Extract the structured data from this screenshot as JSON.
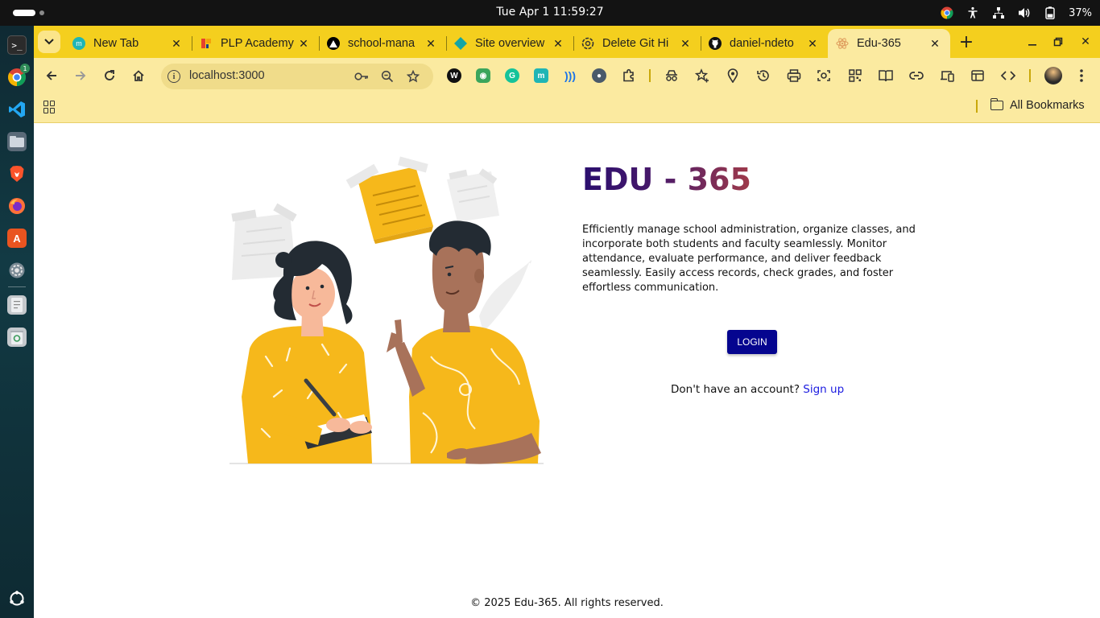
{
  "system": {
    "clock": "Tue Apr 1  11:59:27",
    "battery": "37%",
    "dock_badge": "1"
  },
  "tabs": [
    {
      "title": "New Tab",
      "favicon": "meta-m-icon",
      "color": "#1fb5b5"
    },
    {
      "title": "PLP Academy",
      "favicon": "plp-icon",
      "color": "#e8412c"
    },
    {
      "title": "school-mana",
      "favicon": "vercel-icon",
      "color": "#000000"
    },
    {
      "title": "Site overview",
      "favicon": "netlify-icon",
      "color": "#14a5a5"
    },
    {
      "title": "Delete Git Hi",
      "favicon": "openai-icon",
      "color": "#444444"
    },
    {
      "title": "daniel-ndeto",
      "favicon": "github-icon",
      "color": "#111111"
    },
    {
      "title": "Edu-365",
      "favicon": "react-icon",
      "color": "#e0a060",
      "active": true
    }
  ],
  "toolbar": {
    "url": "localhost:3000"
  },
  "bookmarks": {
    "all_label": "All Bookmarks"
  },
  "hero": {
    "title": "EDU - 365",
    "description": "Efficiently manage school administration, organize classes, and incorporate both students and faculty seamlessly. Monitor attendance, evaluate performance, and deliver feedback seamlessly. Easily access records, check grades, and foster effortless communication.",
    "login_label": "LOGIN",
    "signup_prompt": "Don't have an account?",
    "signup_link": "Sign up"
  },
  "footer": {
    "text": "© 2025 Edu-365. All rights reserved."
  },
  "colors": {
    "chrome_theme": "#f4cf1e",
    "toolbar": "#fbeaa0",
    "login_button": "#05058f",
    "link": "#1a1ae0",
    "illustration_yellow": "#f6b81b"
  }
}
